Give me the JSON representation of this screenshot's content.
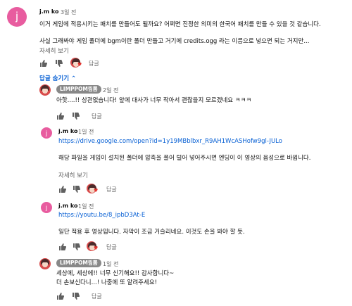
{
  "comments": [
    {
      "author": "j.m ko",
      "time": "3일 전",
      "lines": [
        "이거 게임에 적용시키는 패치를 만들어도 될까요? 어쩌면 진정한 의미의 한국어 패치를 만들 수 있을 것 같습니다.",
        "사실 그래봐야 게임 폴더에 bgm이란 폴더 만들고 거기에 credits.ogg 라는 이름으로 넣으면 되는 거지만..."
      ],
      "read_more": "자세히 보기",
      "reply_label": "답글"
    }
  ],
  "replies_toggle": "답글 숨기기",
  "replies": [
    {
      "author": "LIMPPOM림뽐",
      "time": "2일 전",
      "lines": [
        "아핫....!! 상관없습니다! 앞에 대사가 너무 작아서 괜찮을지 모르겠네요 ㅋㅋㅋ"
      ],
      "reply_label": "답글"
    },
    {
      "author": "j.m ko",
      "time": "1일 전",
      "link": "https://drive.google.com/open?id=1y19MBblbxr_R9AH1WcASHofw9gl-JULo",
      "lines": [
        "해당 파일을 게임이 설치된 폴더에 압축을 풀어 털어 넣어주시면 엔딩이 이 영상의 음성으로 바뀝니다."
      ],
      "read_more": "자세히 보기",
      "reply_label": "답글"
    },
    {
      "author": "j.m ko",
      "time": "1일 전",
      "link": "https://youtu.be/8_ipbD3At-E",
      "lines": [
        "일단 적용 후 영상입니다. 자막이 조금 거슬리네요. 이것도 손을 봐야 할 듯."
      ],
      "reply_label": "답글"
    },
    {
      "author": "LIMPPOM림뽐",
      "time": "1일 전",
      "lines": [
        "세상에, 세상에!! 너무 신기해요!! 감사합니다~",
        "더 손보신다니...! 나중에 또 알려주세요!"
      ],
      "reply_label": "답글"
    }
  ],
  "avatar_letter": "j",
  "colors": {
    "link": "#065fd4",
    "avatar_bg": "#e85c9f",
    "badge_bg": "#888888"
  }
}
